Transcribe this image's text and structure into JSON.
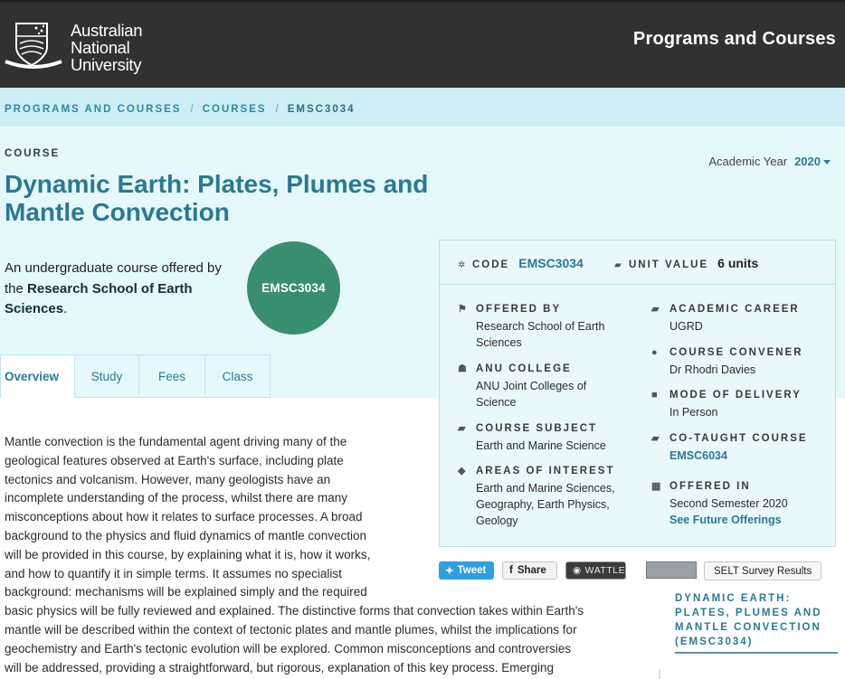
{
  "header": {
    "logo_lines": [
      "Australian",
      "National",
      "University"
    ],
    "site_title": "Programs and Courses"
  },
  "breadcrumb": {
    "items": [
      "PROGRAMS AND COURSES",
      "COURSES",
      "EMSC3034"
    ],
    "separator": "/"
  },
  "hero": {
    "kicker": "COURSE",
    "title": "Dynamic Earth: Plates, Plumes and Mantle Convection",
    "subtitle_pre": "An undergraduate course offered by the ",
    "subtitle_org": "Research School of Earth Sciences",
    "subtitle_post": ".",
    "badge": "EMSC3034",
    "year_label": "Academic Year",
    "year_value": "2020"
  },
  "tabs": [
    {
      "label": "Overview",
      "active": true
    },
    {
      "label": "Study",
      "active": false
    },
    {
      "label": "Fees",
      "active": false
    },
    {
      "label": "Class",
      "active": false
    }
  ],
  "description": "Mantle convection is the fundamental agent driving many of the\ngeological features observed at Earth's surface, including plate\ntectonics and volcanism. However, many geologists have an\nincomplete understanding of the process, whilst there are many\nmisconceptions about how it relates to surface processes. A broad\nbackground to the physics and fluid dynamics of mantle convection\nwill be provided in this course, by explaining what it is, how it works,\nand how to quantify it in simple terms. It assumes no specialist\nbackground: mechanisms will be explained simply and the required\nbasic physics will be fully reviewed and explained. The distinctive forms that convection takes within Earth's\nmantle will be described within the context of tectonic plates and mantle plumes, whilst the implications for\ngeochemistry and Earth's tectonic evolution will be explored. Common misconceptions and controversies\nwill be addressed, providing a straightforward, but rigorous, explanation of this key process. Emerging",
  "card": {
    "code_label": "CODE",
    "code_value": "EMSC3034",
    "unit_label": "UNIT VALUE",
    "unit_value": "6 units",
    "offered_by_label": "OFFERED BY",
    "offered_by_value": "Research School of Earth Sciences",
    "college_label": "ANU COLLEGE",
    "college_value": "ANU Joint Colleges of Science",
    "subject_label": "COURSE SUBJECT",
    "subject_value": "Earth and Marine Science",
    "interest_label": "AREAS OF INTEREST",
    "interest_value": "Earth and Marine Sciences, Geography, Earth Physics, Geology",
    "career_label": "ACADEMIC CAREER",
    "career_value": "UGRD",
    "convener_label": "COURSE CONVENER",
    "convener_value": "Dr Rhodri Davies",
    "delivery_label": "MODE OF DELIVERY",
    "delivery_value": "In Person",
    "cotaught_label": "CO-TAUGHT COURSE",
    "cotaught_value": "EMSC6034",
    "offered_in_label": "OFFERED IN",
    "offered_in_value": "Second Semester 2020",
    "future_link": "See Future Offerings"
  },
  "share": {
    "tweet": "Tweet",
    "fb": "Share",
    "wattle": "WATTLE",
    "selt": "SELT Survey Results"
  },
  "sidebar": {
    "title": "DYNAMIC EARTH: PLATES, PLUMES AND MANTLE CONVECTION (EMSC3034)"
  },
  "colors": {
    "header_bg": "#313131",
    "accent": "#2a7993",
    "badge": "#3a8e70",
    "hero_bg": "#e5f8fb"
  }
}
